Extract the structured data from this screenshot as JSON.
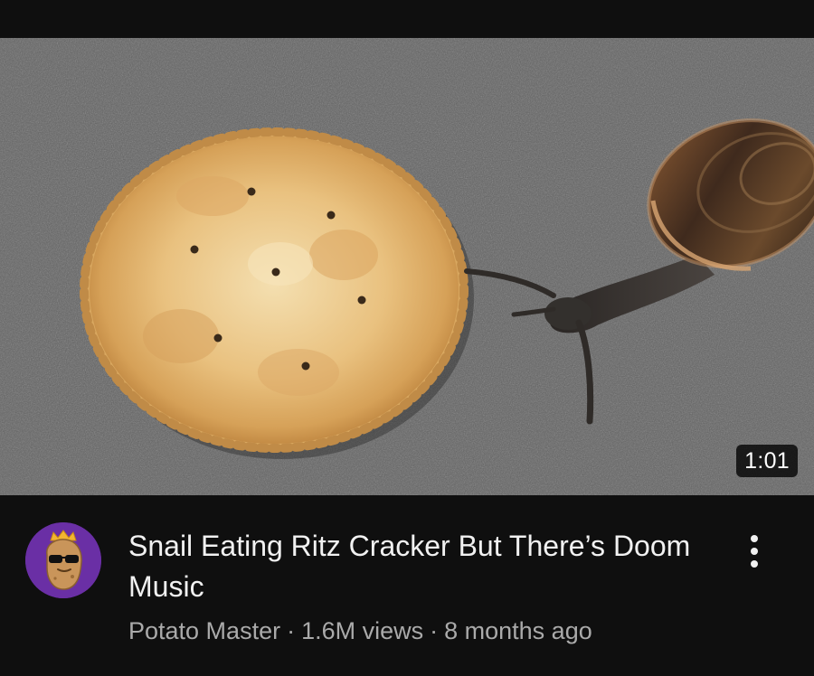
{
  "video": {
    "title": "Snail Eating Ritz Cracker But There’s Doom Music",
    "duration": "1:01",
    "channel": "Potato Master",
    "views": "1.6M views",
    "age": "8 months ago",
    "separator": "·"
  },
  "icons": {
    "more": "three-dots-vertical-icon",
    "avatar": "potato-with-crown-and-sunglasses"
  },
  "colors": {
    "background": "#0f0f0f",
    "title_text": "#f1f1f1",
    "meta_text": "#aaaaaa",
    "avatar_bg": "#6a2fa5",
    "badge_bg": "#000000"
  }
}
